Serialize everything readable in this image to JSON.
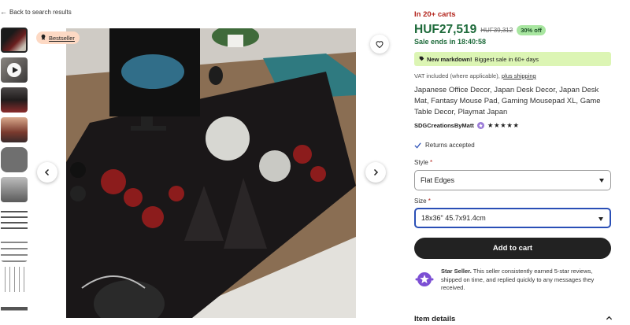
{
  "nav": {
    "back_label": "Back to search results"
  },
  "gallery": {
    "badge": "Bestseller",
    "thumbnail_count": 12
  },
  "product": {
    "in_carts": "In 20+ carts",
    "price": "HUF27,519",
    "original_price": "HUF39,312",
    "discount": "30% off",
    "sale_ends": "Sale ends in 18:40:58",
    "markdown_bold": "New markdown!",
    "markdown_text": "Biggest sale in 60+ days",
    "vat_text": "VAT included (where applicable),",
    "vat_link": "plus shipping",
    "title": "Japanese Office Decor, Japan Desk Decor, Japan Desk Mat, Fantasy Mouse Pad, Gaming Mousepad XL, Game Table Decor, Playmat Japan",
    "seller": "SDGCreationsByMatt",
    "stars": "★★★★★",
    "returns": "Returns accepted"
  },
  "options": {
    "style_label": "Style",
    "style_value": "Flat Edges",
    "size_label": "Size",
    "size_value": "18x36\" 45.7x91.4cm",
    "required_marker": "*"
  },
  "actions": {
    "add_to_cart": "Add to cart"
  },
  "star_seller": {
    "title": "Star Seller.",
    "text": "This seller consistently earned 5-star reviews, shipped on time, and replied quickly to any messages they received."
  },
  "details": {
    "heading": "Item details"
  },
  "colors": {
    "price_green": "#1d6a3a",
    "cart_red": "#b3261e",
    "markdown_bg": "#dcf5b4",
    "badge_bg": "#fdd9c4",
    "focus_blue": "#2a4fb6"
  }
}
